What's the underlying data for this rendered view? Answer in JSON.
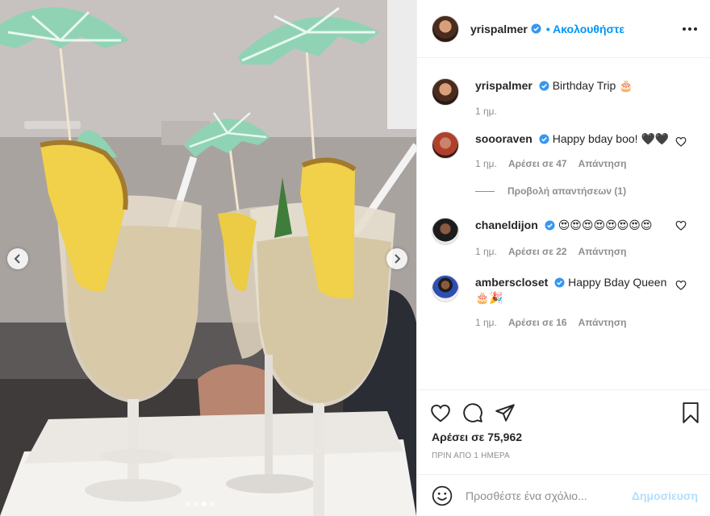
{
  "post": {
    "author": "yrispalmer",
    "follow_label": "Ακολουθήστε",
    "likes_text": "Αρέσει σε 75,962",
    "time_ago": "ΠΡΙΝ ΑΠΟ 1 ΗΜΕΡΑ",
    "carousel_dots": 4,
    "carousel_active_index": 2
  },
  "caption": {
    "username": "yrispalmer",
    "text": "Birthday Trip 🎂",
    "time": "1 ημ."
  },
  "comments": [
    {
      "username": "soooraven",
      "text": "Happy bday boo! 🖤🖤",
      "time": "1 ημ.",
      "likes": "Αρέσει σε 47",
      "reply": "Απάντηση",
      "view_replies": "Προβολή απαντήσεων (1)"
    },
    {
      "username": "chaneldijon",
      "text": "😍😍😍😍😍😍😍😍",
      "time": "1 ημ.",
      "likes": "Αρέσει σε 22",
      "reply": "Απάντηση"
    },
    {
      "username": "amberscloset",
      "text": "Happy Bday Queen🎂🎉",
      "time": "1 ημ.",
      "likes": "Αρέσει σε 16",
      "reply": "Απάντηση"
    }
  ],
  "add_comment": {
    "placeholder": "Προσθέστε ένα σχόλιο...",
    "post_label": "Δημοσίευση"
  },
  "colors": {
    "accent": "#0095f6",
    "post_disabled": "#b2dffc",
    "muted": "#8e8e8e",
    "text": "#262626",
    "umbrella": "#8fd3b4"
  },
  "icons": {
    "like": "heart-icon",
    "comment": "comment-icon",
    "share": "share-icon",
    "save": "bookmark-icon",
    "emoji": "smiley-icon",
    "more": "more-options-icon",
    "verified": "verified-badge-icon"
  }
}
